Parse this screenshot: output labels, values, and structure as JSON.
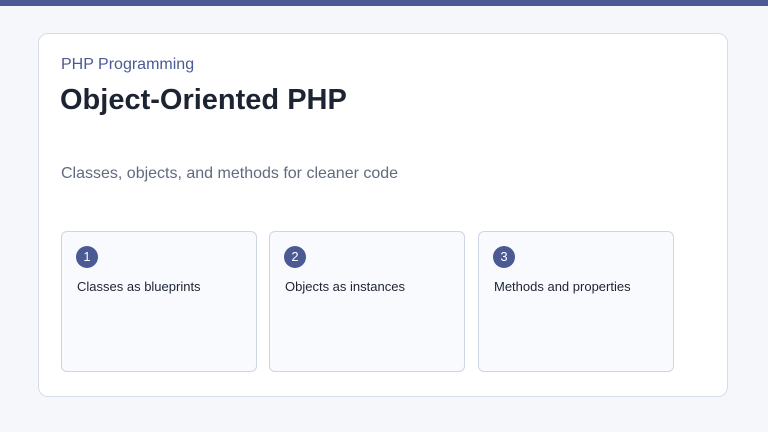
{
  "slide": {
    "subtitle": "PHP Programming",
    "title": "Object-Oriented PHP",
    "tagline": "Classes, objects, and methods for cleaner code"
  },
  "features": [
    {
      "number": "1",
      "label": "Classes as blueprints"
    },
    {
      "number": "2",
      "label": "Objects as instances"
    },
    {
      "number": "3",
      "label": "Methods and properties"
    }
  ],
  "colors": {
    "accent": "#4b5a94",
    "title_text": "#1c2433",
    "muted_text": "#5f6b7e",
    "background": "#f5f7fa",
    "card_border": "#d6dde8"
  }
}
